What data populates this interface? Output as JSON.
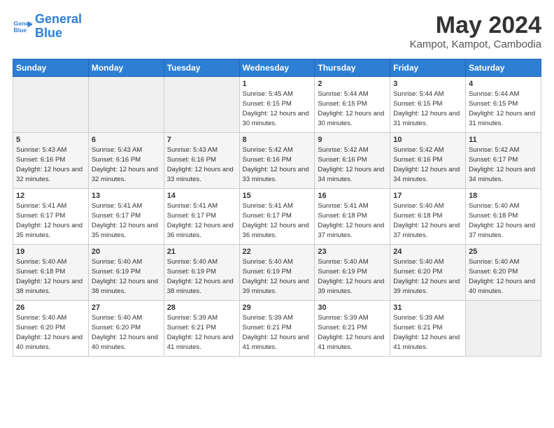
{
  "header": {
    "logo_line1": "General",
    "logo_line2": "Blue",
    "month_title": "May 2024",
    "location": "Kampot, Kampot, Cambodia"
  },
  "days_of_week": [
    "Sunday",
    "Monday",
    "Tuesday",
    "Wednesday",
    "Thursday",
    "Friday",
    "Saturday"
  ],
  "weeks": [
    [
      {
        "num": "",
        "info": ""
      },
      {
        "num": "",
        "info": ""
      },
      {
        "num": "",
        "info": ""
      },
      {
        "num": "1",
        "info": "Sunrise: 5:45 AM\nSunset: 6:15 PM\nDaylight: 12 hours\nand 30 minutes."
      },
      {
        "num": "2",
        "info": "Sunrise: 5:44 AM\nSunset: 6:15 PM\nDaylight: 12 hours\nand 30 minutes."
      },
      {
        "num": "3",
        "info": "Sunrise: 5:44 AM\nSunset: 6:15 PM\nDaylight: 12 hours\nand 31 minutes."
      },
      {
        "num": "4",
        "info": "Sunrise: 5:44 AM\nSunset: 6:15 PM\nDaylight: 12 hours\nand 31 minutes."
      }
    ],
    [
      {
        "num": "5",
        "info": "Sunrise: 5:43 AM\nSunset: 6:16 PM\nDaylight: 12 hours\nand 32 minutes."
      },
      {
        "num": "6",
        "info": "Sunrise: 5:43 AM\nSunset: 6:16 PM\nDaylight: 12 hours\nand 32 minutes."
      },
      {
        "num": "7",
        "info": "Sunrise: 5:43 AM\nSunset: 6:16 PM\nDaylight: 12 hours\nand 33 minutes."
      },
      {
        "num": "8",
        "info": "Sunrise: 5:42 AM\nSunset: 6:16 PM\nDaylight: 12 hours\nand 33 minutes."
      },
      {
        "num": "9",
        "info": "Sunrise: 5:42 AM\nSunset: 6:16 PM\nDaylight: 12 hours\nand 34 minutes."
      },
      {
        "num": "10",
        "info": "Sunrise: 5:42 AM\nSunset: 6:16 PM\nDaylight: 12 hours\nand 34 minutes."
      },
      {
        "num": "11",
        "info": "Sunrise: 5:42 AM\nSunset: 6:17 PM\nDaylight: 12 hours\nand 34 minutes."
      }
    ],
    [
      {
        "num": "12",
        "info": "Sunrise: 5:41 AM\nSunset: 6:17 PM\nDaylight: 12 hours\nand 35 minutes."
      },
      {
        "num": "13",
        "info": "Sunrise: 5:41 AM\nSunset: 6:17 PM\nDaylight: 12 hours\nand 35 minutes."
      },
      {
        "num": "14",
        "info": "Sunrise: 5:41 AM\nSunset: 6:17 PM\nDaylight: 12 hours\nand 36 minutes."
      },
      {
        "num": "15",
        "info": "Sunrise: 5:41 AM\nSunset: 6:17 PM\nDaylight: 12 hours\nand 36 minutes."
      },
      {
        "num": "16",
        "info": "Sunrise: 5:41 AM\nSunset: 6:18 PM\nDaylight: 12 hours\nand 37 minutes."
      },
      {
        "num": "17",
        "info": "Sunrise: 5:40 AM\nSunset: 6:18 PM\nDaylight: 12 hours\nand 37 minutes."
      },
      {
        "num": "18",
        "info": "Sunrise: 5:40 AM\nSunset: 6:18 PM\nDaylight: 12 hours\nand 37 minutes."
      }
    ],
    [
      {
        "num": "19",
        "info": "Sunrise: 5:40 AM\nSunset: 6:18 PM\nDaylight: 12 hours\nand 38 minutes."
      },
      {
        "num": "20",
        "info": "Sunrise: 5:40 AM\nSunset: 6:19 PM\nDaylight: 12 hours\nand 38 minutes."
      },
      {
        "num": "21",
        "info": "Sunrise: 5:40 AM\nSunset: 6:19 PM\nDaylight: 12 hours\nand 38 minutes."
      },
      {
        "num": "22",
        "info": "Sunrise: 5:40 AM\nSunset: 6:19 PM\nDaylight: 12 hours\nand 39 minutes."
      },
      {
        "num": "23",
        "info": "Sunrise: 5:40 AM\nSunset: 6:19 PM\nDaylight: 12 hours\nand 39 minutes."
      },
      {
        "num": "24",
        "info": "Sunrise: 5:40 AM\nSunset: 6:20 PM\nDaylight: 12 hours\nand 39 minutes."
      },
      {
        "num": "25",
        "info": "Sunrise: 5:40 AM\nSunset: 6:20 PM\nDaylight: 12 hours\nand 40 minutes."
      }
    ],
    [
      {
        "num": "26",
        "info": "Sunrise: 5:40 AM\nSunset: 6:20 PM\nDaylight: 12 hours\nand 40 minutes."
      },
      {
        "num": "27",
        "info": "Sunrise: 5:40 AM\nSunset: 6:20 PM\nDaylight: 12 hours\nand 40 minutes."
      },
      {
        "num": "28",
        "info": "Sunrise: 5:39 AM\nSunset: 6:21 PM\nDaylight: 12 hours\nand 41 minutes."
      },
      {
        "num": "29",
        "info": "Sunrise: 5:39 AM\nSunset: 6:21 PM\nDaylight: 12 hours\nand 41 minutes."
      },
      {
        "num": "30",
        "info": "Sunrise: 5:39 AM\nSunset: 6:21 PM\nDaylight: 12 hours\nand 41 minutes."
      },
      {
        "num": "31",
        "info": "Sunrise: 5:39 AM\nSunset: 6:21 PM\nDaylight: 12 hours\nand 41 minutes."
      },
      {
        "num": "",
        "info": ""
      }
    ]
  ]
}
